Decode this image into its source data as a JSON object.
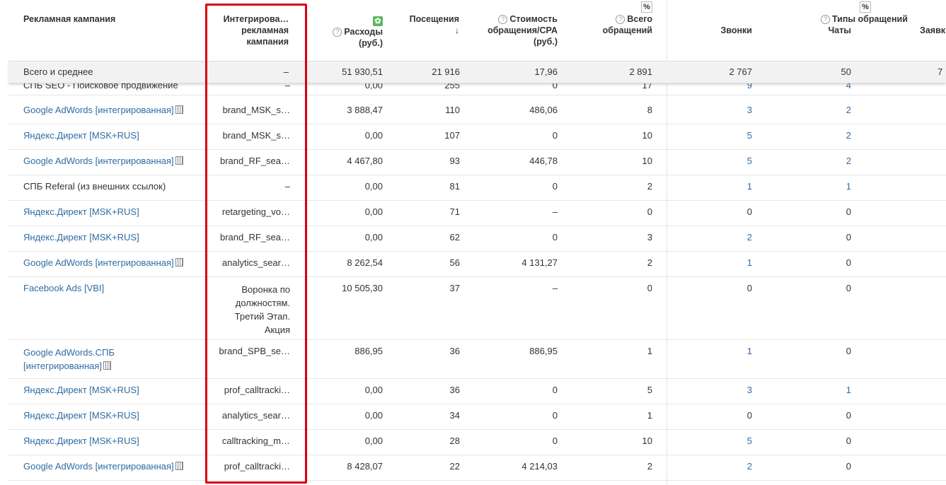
{
  "header": {
    "campaign": "Рекламная кампания",
    "integrated": [
      "Интегрирова…",
      "рекламная",
      "кампания"
    ],
    "expenses": [
      "Расходы",
      "(руб.)"
    ],
    "visits": "Посещения",
    "cpa": [
      "Стоимость",
      "обращения/CPA",
      "(руб.)"
    ],
    "total_requests": [
      "Всего",
      "обращений"
    ],
    "request_types": "Типы обращений",
    "calls": "Звонки",
    "chats": "Чаты",
    "orders": "Заявк",
    "pct": "%",
    "help": "?",
    "sort_icon": "↓"
  },
  "totals": {
    "label": "Всего и среднее",
    "integrated": "–",
    "expenses": "51 930,51",
    "visits": "21 916",
    "cpa": "17,96",
    "total": "2 891",
    "calls": "2 767",
    "chats": "50",
    "orders": "7"
  },
  "rows": [
    {
      "campaign": "СПБ SEO - Поисковое продвижение",
      "link": false,
      "calc": false,
      "integrated": "–",
      "expenses": "0,00",
      "visits": "255",
      "cpa": "0",
      "total": "17",
      "calls": "9",
      "calls_link": true,
      "chats": "4",
      "chats_link": true
    },
    {
      "campaign": "Google AdWords [интегрированная]",
      "link": true,
      "calc": true,
      "integrated": "brand_MSK_s…",
      "expenses": "3 888,47",
      "visits": "110",
      "cpa": "486,06",
      "total": "8",
      "calls": "3",
      "calls_link": true,
      "chats": "2",
      "chats_link": true
    },
    {
      "campaign": "Яндекс.Директ [MSK+RUS]",
      "link": true,
      "calc": false,
      "integrated": "brand_MSK_s…",
      "expenses": "0,00",
      "visits": "107",
      "cpa": "0",
      "total": "10",
      "calls": "5",
      "calls_link": true,
      "chats": "2",
      "chats_link": true
    },
    {
      "campaign": "Google AdWords [интегрированная]",
      "link": true,
      "calc": true,
      "integrated": "brand_RF_sea…",
      "expenses": "4 467,80",
      "visits": "93",
      "cpa": "446,78",
      "total": "10",
      "calls": "5",
      "calls_link": true,
      "chats": "2",
      "chats_link": true
    },
    {
      "campaign": "СПБ Referal (из внешних ссылок)",
      "link": false,
      "calc": false,
      "integrated": "–",
      "expenses": "0,00",
      "visits": "81",
      "cpa": "0",
      "total": "2",
      "calls": "1",
      "calls_link": true,
      "chats": "1",
      "chats_link": true
    },
    {
      "campaign": "Яндекс.Директ [MSK+RUS]",
      "link": true,
      "calc": false,
      "integrated": "retargeting_vo…",
      "expenses": "0,00",
      "visits": "71",
      "cpa": "–",
      "total": "0",
      "calls": "0",
      "calls_link": false,
      "chats": "0",
      "chats_link": false
    },
    {
      "campaign": "Яндекс.Директ [MSK+RUS]",
      "link": true,
      "calc": false,
      "integrated": "brand_RF_sea…",
      "expenses": "0,00",
      "visits": "62",
      "cpa": "0",
      "total": "3",
      "calls": "2",
      "calls_link": true,
      "chats": "0",
      "chats_link": false
    },
    {
      "campaign": "Google AdWords [интегрированная]",
      "link": true,
      "calc": true,
      "integrated": "analytics_sear…",
      "expenses": "8 262,54",
      "visits": "56",
      "cpa": "4 131,27",
      "total": "2",
      "calls": "1",
      "calls_link": true,
      "chats": "0",
      "chats_link": false
    },
    {
      "campaign": "Facebook Ads [VBI]",
      "link": true,
      "calc": false,
      "integrated": "Воронка по должностям. Третий Этап. Акция",
      "expenses": "10 505,30",
      "visits": "37",
      "cpa": "–",
      "total": "0",
      "calls": "0",
      "calls_link": false,
      "chats": "0",
      "chats_link": false
    },
    {
      "campaign": "Google AdWords.СПБ [интегрированная]",
      "link": true,
      "calc": true,
      "integrated": "brand_SPB_se…",
      "expenses": "886,95",
      "visits": "36",
      "cpa": "886,95",
      "total": "1",
      "calls": "1",
      "calls_link": true,
      "chats": "0",
      "chats_link": false
    },
    {
      "campaign": "Яндекс.Директ [MSK+RUS]",
      "link": true,
      "calc": false,
      "integrated": "prof_calltracki…",
      "expenses": "0,00",
      "visits": "36",
      "cpa": "0",
      "total": "5",
      "calls": "3",
      "calls_link": true,
      "chats": "1",
      "chats_link": true
    },
    {
      "campaign": "Яндекс.Директ [MSK+RUS]",
      "link": true,
      "calc": false,
      "integrated": "analytics_sear…",
      "expenses": "0,00",
      "visits": "34",
      "cpa": "0",
      "total": "1",
      "calls": "0",
      "calls_link": false,
      "chats": "0",
      "chats_link": false
    },
    {
      "campaign": "Яндекс.Директ [MSK+RUS]",
      "link": true,
      "calc": false,
      "integrated": "calltracking_m…",
      "expenses": "0,00",
      "visits": "28",
      "cpa": "0",
      "total": "10",
      "calls": "5",
      "calls_link": true,
      "chats": "0",
      "chats_link": false
    },
    {
      "campaign": "Google AdWords [интегрированная]",
      "link": true,
      "calc": true,
      "integrated": "prof_calltracki…",
      "expenses": "8 428,07",
      "visits": "22",
      "cpa": "4 214,03",
      "total": "2",
      "calls": "2",
      "calls_link": true,
      "chats": "0",
      "chats_link": false
    }
  ],
  "colors": {
    "link": "#2f6ca4",
    "highlight": "#d8000f",
    "gear": "#5cb85c"
  }
}
